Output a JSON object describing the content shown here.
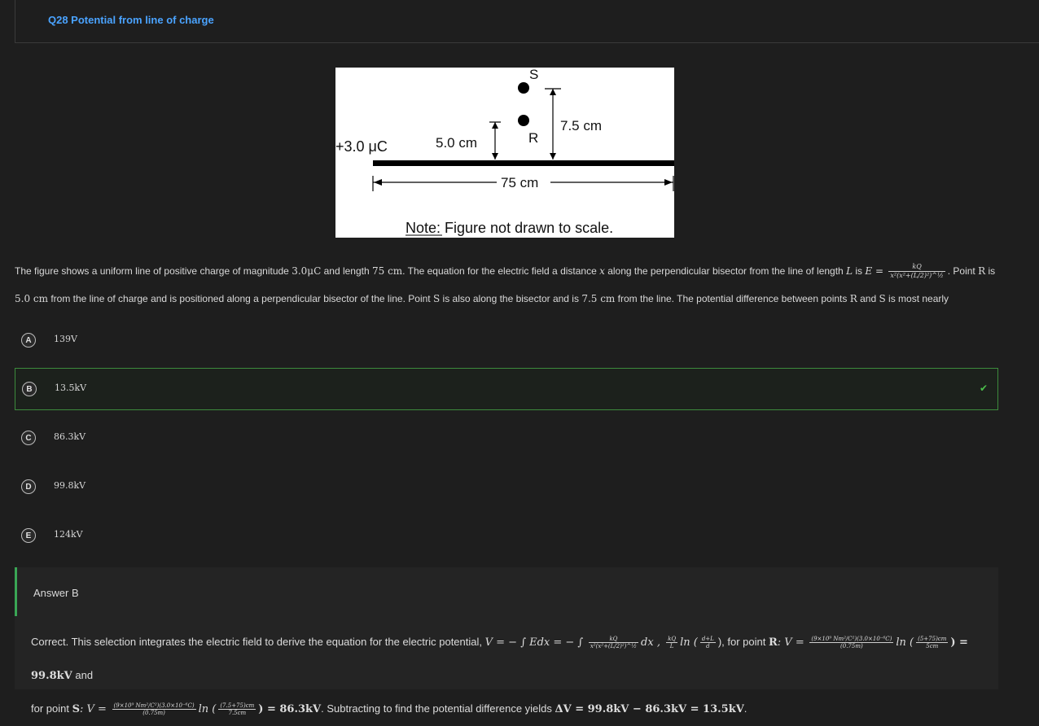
{
  "header": {
    "title": "Q28 Potential from line of charge"
  },
  "figure": {
    "charge_label": "+3.0 μC",
    "label_s": "S",
    "label_r": "R",
    "dist_r": "5.0 cm",
    "dist_s": "7.5 cm",
    "length": "75 cm",
    "note": "Note: Figure not drawn to scale."
  },
  "question": {
    "p1": "The figure shows a uniform line of positive charge of magnitude ",
    "charge": "3.0μC",
    "p2": " and length ",
    "len": "75 cm",
    "p3": ". The equation for the electric field a distance ",
    "x": "x",
    "p4": " along the perpendicular bisector from the line of length ",
    "L": "L",
    "p5": " is ",
    "E": "E =",
    "frac_num": "kQ",
    "frac_den": "x²(x²+(L/2)²)^½",
    "p6": ". Point ",
    "R": "R",
    "p7": " is",
    "dist_r": "5.0 cm",
    "p8": " from the line of charge and is positioned along a perpendicular bisector of the line. Point ",
    "S": "S",
    "p9": " is also along the bisector and is ",
    "dist_s": "7.5 cm",
    "p10": " from the line. The potential difference between points ",
    "R2": "R",
    "p11": " and ",
    "S2": "S",
    "p12": " is most nearly"
  },
  "choices": [
    {
      "letter": "A",
      "text": "139V",
      "correct": false
    },
    {
      "letter": "B",
      "text": "13.5kV",
      "correct": true
    },
    {
      "letter": "C",
      "text": "86.3kV",
      "correct": false
    },
    {
      "letter": "D",
      "text": "99.8kV",
      "correct": false
    },
    {
      "letter": "E",
      "text": "124kV",
      "correct": false
    }
  ],
  "answer": {
    "label": "Answer B",
    "e1": "Correct. This selection integrates the electric field to derive the equation for the electric potential, ",
    "eq1": "V = − ∫ Edx = − ∫",
    "eq1b": "dx , ",
    "eq1c": "ln (",
    "eq1d": "), for point ",
    "pointR": "R",
    "eq2": ": V =",
    "eq2b": "ln (",
    "eq2c": ") = 99.8kV",
    "e2": " and",
    "e3": "for point ",
    "pointS": "S",
    "eq3": ": V =",
    "eq3b": "ln (",
    "eq3c": ") = 86.3kV",
    "e4": ". Subtracting to find the potential difference yields ",
    "eq4": "ΔV = 99.8kV − 86.3kV = 13.5kV",
    "e5": "."
  }
}
